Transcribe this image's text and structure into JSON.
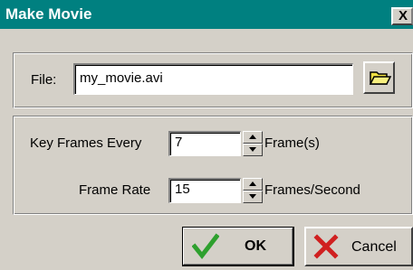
{
  "window": {
    "title": "Make Movie",
    "close_label": "X"
  },
  "file": {
    "label": "File:",
    "value": "my_movie.avi",
    "browse_icon": "open-folder-icon"
  },
  "key_frames": {
    "label": "Key Frames Every",
    "value": "7",
    "unit": "Frame(s)"
  },
  "frame_rate": {
    "label": "Frame Rate",
    "value": "15",
    "unit": "Frames/Second"
  },
  "buttons": {
    "ok_label": "OK",
    "ok_icon": "green-check-icon",
    "cancel_label": "Cancel",
    "cancel_icon": "red-x-icon"
  },
  "colors": {
    "titlebar": "#008080",
    "dialog_bg": "#d4d0c8",
    "check": "#2ea02e",
    "x": "#d02020",
    "folder": "#f0e040"
  }
}
